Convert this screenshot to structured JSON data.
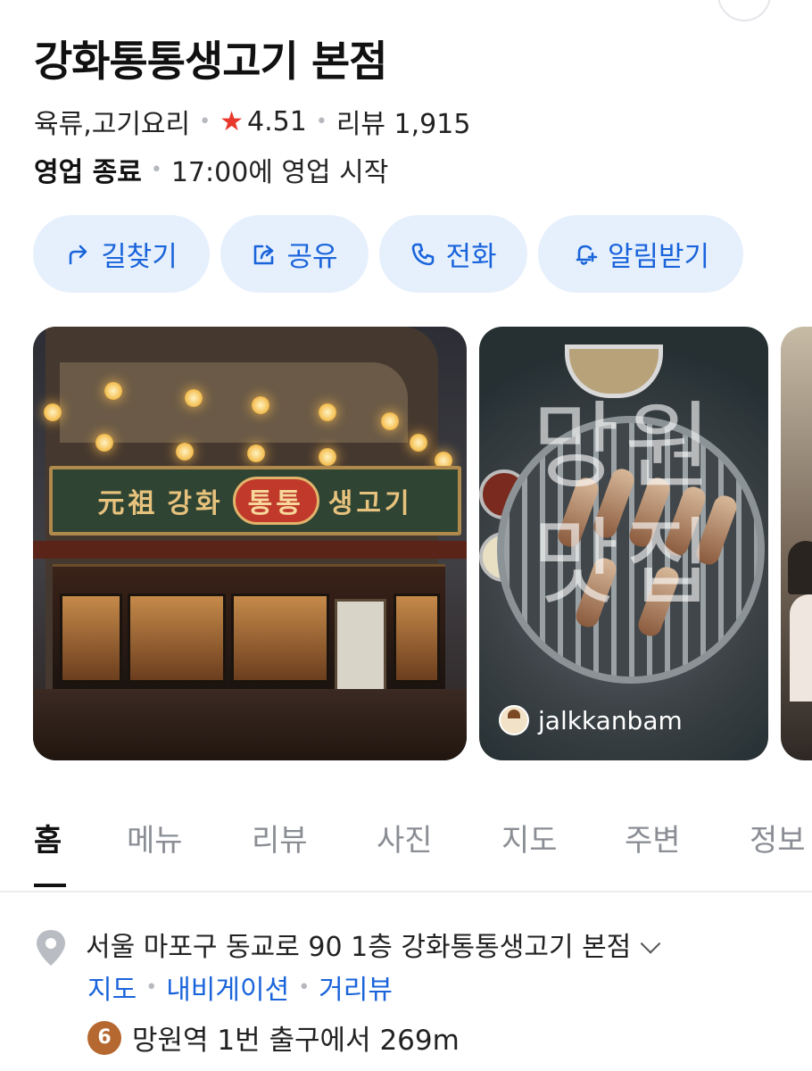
{
  "place": {
    "name": "강화통통생고기 본점",
    "category": "육류,고기요리",
    "rating": "4.51",
    "review_label": "리뷰 1,915"
  },
  "hours": {
    "status": "영업 종료",
    "next_open": "17:00에 영업 시작"
  },
  "actions": [
    {
      "label": "길찾기",
      "icon": "directions-arrow-icon"
    },
    {
      "label": "공유",
      "icon": "share-icon"
    },
    {
      "label": "전화",
      "icon": "phone-icon"
    },
    {
      "label": "알림받기",
      "icon": "bell-plus-icon"
    }
  ],
  "photos": {
    "storefront_sign": {
      "left": "元祖",
      "middle_left": "강화",
      "oval": "통통",
      "middle_right": "생고기"
    },
    "food_watermark": "망원 맛집",
    "food_credit": "jalkkanbam"
  },
  "tabs": [
    "홈",
    "메뉴",
    "리뷰",
    "사진",
    "지도",
    "주변",
    "정보"
  ],
  "active_tab": "홈",
  "location": {
    "address": "서울 마포구 동교로 90 1층 강화통통생고기 본점",
    "links": [
      "지도",
      "내비게이션",
      "거리뷰"
    ],
    "subway_line": "6",
    "transit": "망원역 1번 출구에서 269m"
  },
  "colors": {
    "accent": "#1a64db",
    "action_bg": "#e6f0fd",
    "star": "#e8372c",
    "subway_line_6": "#b5682f"
  }
}
